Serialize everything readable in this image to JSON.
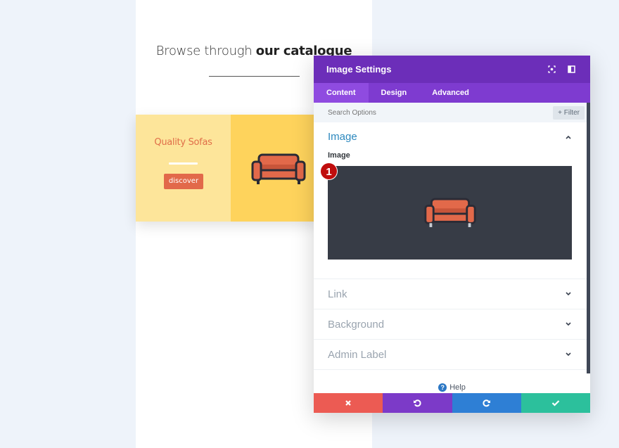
{
  "page": {
    "heading_light": "Browse through ",
    "heading_bold": "our catalogue"
  },
  "promo": {
    "title": "Quality Sofas",
    "button_label": "discover",
    "colors": {
      "left": "#fde59a",
      "right": "#fed35c",
      "accent": "#e2694a"
    }
  },
  "modal": {
    "title": "Image Settings",
    "header_icons": [
      "focus-icon",
      "sidebar-toggle-icon"
    ],
    "tabs": [
      {
        "label": "Content",
        "active": true
      },
      {
        "label": "Design",
        "active": false
      },
      {
        "label": "Advanced",
        "active": false
      }
    ],
    "search": {
      "placeholder": "Search Options",
      "filter_label": "Filter"
    },
    "open_section": {
      "title": "Image",
      "field_label": "Image",
      "badge": "1"
    },
    "sections": [
      {
        "label": "Link"
      },
      {
        "label": "Background"
      },
      {
        "label": "Admin Label"
      }
    ],
    "help_label": "Help",
    "footer": {
      "buttons": [
        {
          "name": "cancel",
          "icon": "close-icon",
          "color": "#ec5b53"
        },
        {
          "name": "undo",
          "icon": "undo-icon",
          "color": "#7c3ac8"
        },
        {
          "name": "redo",
          "icon": "redo-icon",
          "color": "#2e7fd5"
        },
        {
          "name": "save",
          "icon": "check-icon",
          "color": "#2cc09c"
        }
      ]
    },
    "colors": {
      "header": "#6c2eb9",
      "tabs": "#7e3bd0",
      "section_title": "#2c88be"
    }
  }
}
